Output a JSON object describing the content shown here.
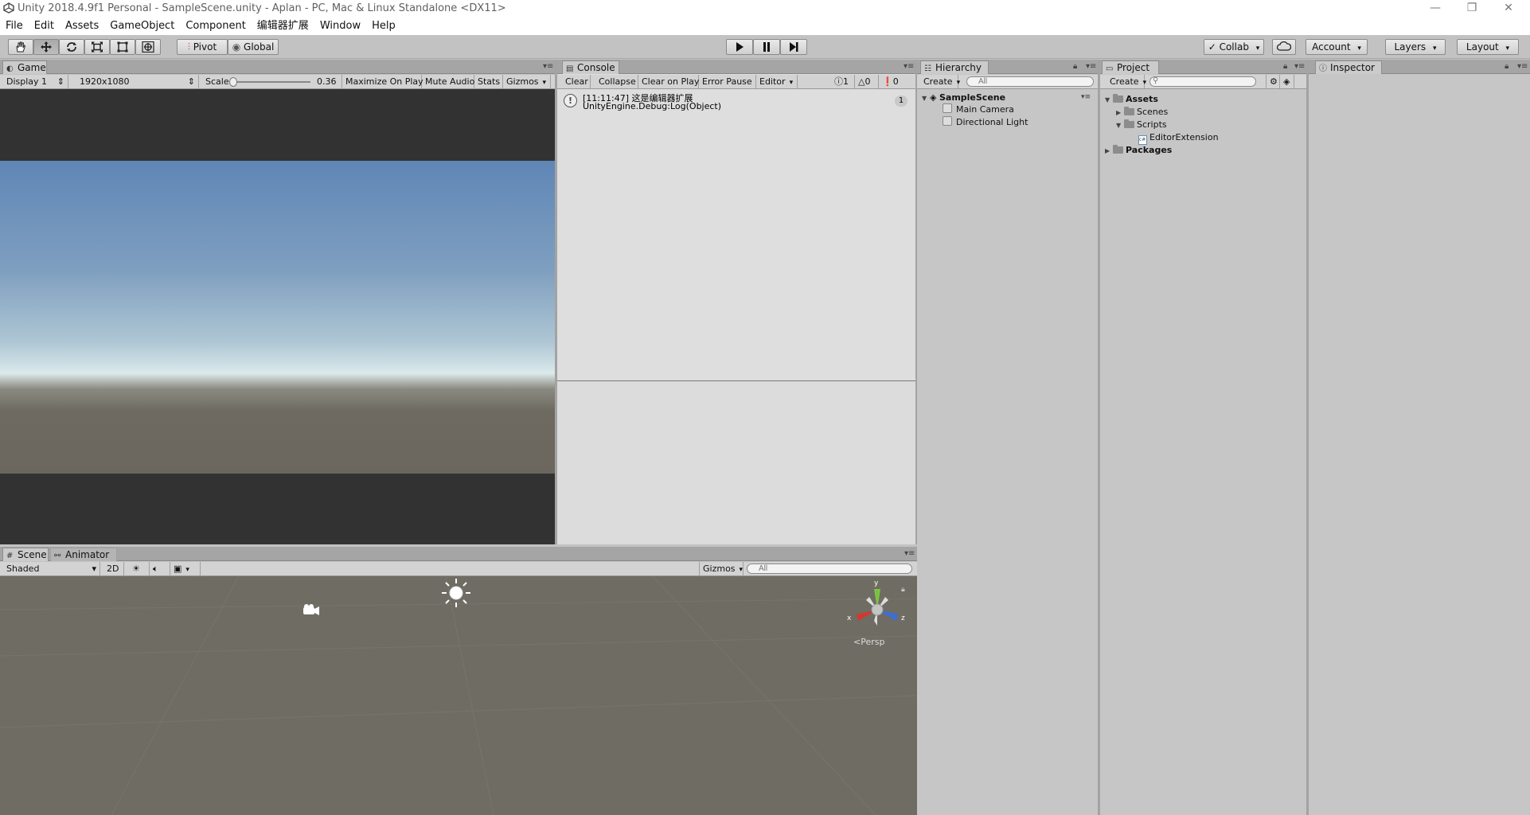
{
  "window": {
    "title": "Unity 2018.4.9f1 Personal - SampleScene.unity - Aplan - PC, Mac & Linux Standalone <DX11>",
    "controls": {
      "minimize": "—",
      "restore": "❐",
      "close": "✕"
    }
  },
  "menu": [
    "File",
    "Edit",
    "Assets",
    "GameObject",
    "Component",
    "编辑器扩展",
    "Window",
    "Help"
  ],
  "toolbar": {
    "pivot": "Pivot",
    "global": "Global",
    "collab": "Collab",
    "account": "Account",
    "layers": "Layers",
    "layout": "Layout"
  },
  "game": {
    "tab": "Game",
    "display": "Display 1",
    "resolution": "1920x1080",
    "scale_label": "Scale",
    "scale_value": "0.36",
    "maximize": "Maximize On Play",
    "mute": "Mute Audio",
    "stats": "Stats",
    "gizmos": "Gizmos"
  },
  "console": {
    "tab": "Console",
    "buttons": {
      "clear": "Clear",
      "collapse": "Collapse",
      "clear_on_play": "Clear on Play",
      "error_pause": "Error Pause",
      "editor": "Editor"
    },
    "counts": {
      "info": "1",
      "warning": "0",
      "error": "0"
    },
    "entry": {
      "line1": "[11:11:47] 这是编辑器扩展",
      "line2": "UnityEngine.Debug:Log(Object)",
      "count": "1"
    }
  },
  "hierarchy": {
    "tab": "Hierarchy",
    "create": "Create",
    "search_placeholder": "All",
    "scene": "SampleScene",
    "items": [
      "Main Camera",
      "Directional Light"
    ]
  },
  "project": {
    "tab": "Project",
    "create": "Create",
    "assets": "Assets",
    "scenes": "Scenes",
    "scripts": "Scripts",
    "script_file": "EditorExtension",
    "packages": "Packages"
  },
  "inspector": {
    "tab": "Inspector"
  },
  "scene": {
    "tab": "Scene",
    "animator_tab": "Animator",
    "shading": "Shaded",
    "mode2d": "2D",
    "gizmos": "Gizmos",
    "search_placeholder": "All",
    "persp": "Persp",
    "axis_x": "x",
    "axis_y": "y",
    "axis_z": "z"
  },
  "colors": {
    "sky_top": "#5f86b6",
    "horizon": "#cfe0e6",
    "ground": "#6e6a62",
    "scene_bg": "#6f6c64",
    "panel_bg": "#c2c2c2"
  }
}
